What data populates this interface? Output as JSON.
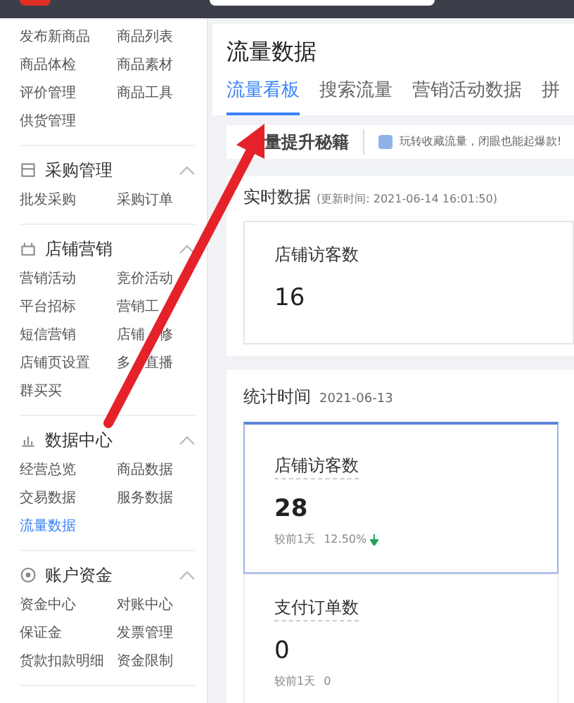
{
  "sidebar": {
    "sections": [
      {
        "items": [
          {
            "label": "发布新商品",
            "selected": false
          },
          {
            "label": "商品列表",
            "selected": false
          },
          {
            "label": "商品体检",
            "selected": false
          },
          {
            "label": "商品素材",
            "selected": false
          },
          {
            "label": "评价管理",
            "selected": false
          },
          {
            "label": "商品工具",
            "selected": false
          },
          {
            "label": "供货管理",
            "selected": false
          }
        ]
      },
      {
        "title": "采购管理",
        "kind": "box",
        "expanded": true,
        "items": [
          {
            "label": "批发采购",
            "selected": false
          },
          {
            "label": "采购订单",
            "selected": false
          }
        ]
      },
      {
        "title": "店铺营销",
        "kind": "shop",
        "expanded": true,
        "items": [
          {
            "label": "营销活动",
            "selected": false
          },
          {
            "label": "竞价活动",
            "selected": false
          },
          {
            "label": "平台招标",
            "selected": false
          },
          {
            "label": "营销工",
            "selected": false
          },
          {
            "label": "短信营销",
            "selected": false
          },
          {
            "label": "店铺",
            "tail": "修",
            "selected": false
          },
          {
            "label": "店铺页设置",
            "selected": false
          },
          {
            "label": "多",
            "tail": "直播",
            "selected": false
          },
          {
            "label": "群买买",
            "selected": false
          }
        ]
      },
      {
        "title": "数据中心",
        "kind": "chart",
        "expanded": true,
        "items": [
          {
            "label": "经营总览",
            "selected": false
          },
          {
            "label": "商品数据",
            "selected": false
          },
          {
            "label": "交易数据",
            "selected": false
          },
          {
            "label": "服务数据",
            "selected": false
          },
          {
            "label": "流量数据",
            "selected": true
          }
        ]
      },
      {
        "title": "账户资金",
        "kind": "coin",
        "expanded": true,
        "items": [
          {
            "label": "资金中心",
            "selected": false
          },
          {
            "label": "对账中心",
            "selected": false
          },
          {
            "label": "保证金",
            "selected": false
          },
          {
            "label": "发票管理",
            "selected": false
          },
          {
            "label": "货款扣款明细",
            "selected": false
          },
          {
            "label": "资金限制",
            "selected": false
          }
        ]
      }
    ]
  },
  "page_title": "流量数据",
  "tabs": [
    {
      "label": "流量看板",
      "selected": true
    },
    {
      "label": "搜索流量",
      "selected": false
    },
    {
      "label": "营销活动数据",
      "selected": false
    },
    {
      "label": "拼",
      "selected": false
    }
  ],
  "banner": {
    "title": "量提升秘籍",
    "tip": "玩转收藏流量，闭眼也能起爆款!"
  },
  "realtime": {
    "title": "实时数据",
    "updated": "(更新时间: 2021-06-14 16:01:50)",
    "cards": [
      {
        "label": "店铺访客数",
        "value": "16"
      }
    ]
  },
  "stats": {
    "title": "统计时间",
    "date": "2021-06-13",
    "cards": [
      {
        "label": "店铺访客数",
        "value": "28",
        "compare_label": "较前1天",
        "compare_value": "12.50%",
        "falling": true,
        "selected": true
      },
      {
        "label": "支付订单数",
        "value": "0",
        "compare_label": "较前1天",
        "compare_value": "0",
        "falling": false,
        "selected": false
      }
    ]
  }
}
